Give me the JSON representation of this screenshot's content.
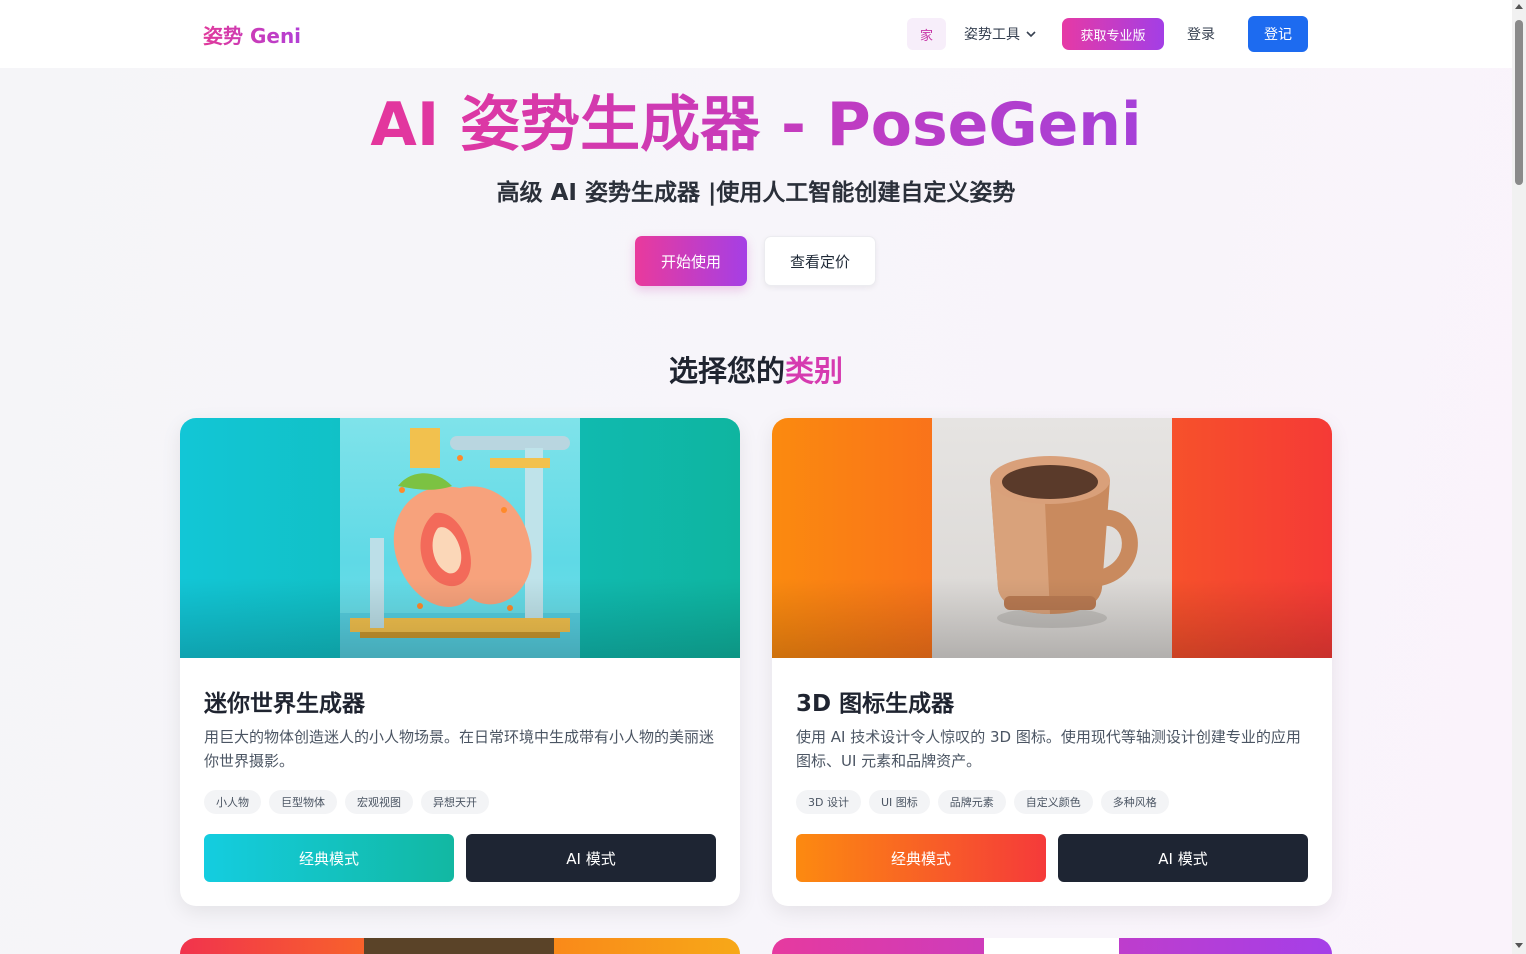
{
  "header": {
    "logo": "姿势 Geni",
    "nav": {
      "home": "家",
      "tools": "姿势工具",
      "pro": "获取专业版",
      "login": "登录",
      "register": "登记"
    }
  },
  "hero": {
    "title": "AI 姿势生成器 - PoseGeni",
    "subtitle": "高级 AI 姿势生成器 |使用人工智能创建自定义姿势",
    "start_button": "开始使用",
    "pricing_button": "查看定价"
  },
  "section": {
    "title_prefix": "选择您的",
    "title_highlight": "类别"
  },
  "cards": [
    {
      "title": "迷你世界生成器",
      "description": "用巨大的物体创造迷人的小人物场景。在日常环境中生成带有小人物的美丽迷你世界摄影。",
      "tags": [
        "小人物",
        "巨型物体",
        "宏观视图",
        "异想天开"
      ],
      "classic_button": "经典模式",
      "ai_button": "AI 模式"
    },
    {
      "title": "3D 图标生成器",
      "description": "使用 AI 技术设计令人惊叹的 3D 图标。使用现代等轴测设计创建专业的应用图标、UI 元素和品牌资产。",
      "tags": [
        "3D 设计",
        "UI 图标",
        "品牌元素",
        "自定义颜色",
        "多种风格"
      ],
      "classic_button": "经典模式",
      "ai_button": "AI 模式"
    }
  ],
  "colors": {
    "brand_pink": "#e4369c",
    "brand_purple": "#a640d8",
    "register_blue": "#1d6bf0",
    "dark_button": "#1e2533",
    "teal_gradient": "#14cde0",
    "orange_gradient": "#fc8a10"
  },
  "icons": {
    "dropdown": "chevron-down-icon",
    "card1_image": "miniature-peach-world-image",
    "card2_image": "3d-mug-icon-image"
  }
}
